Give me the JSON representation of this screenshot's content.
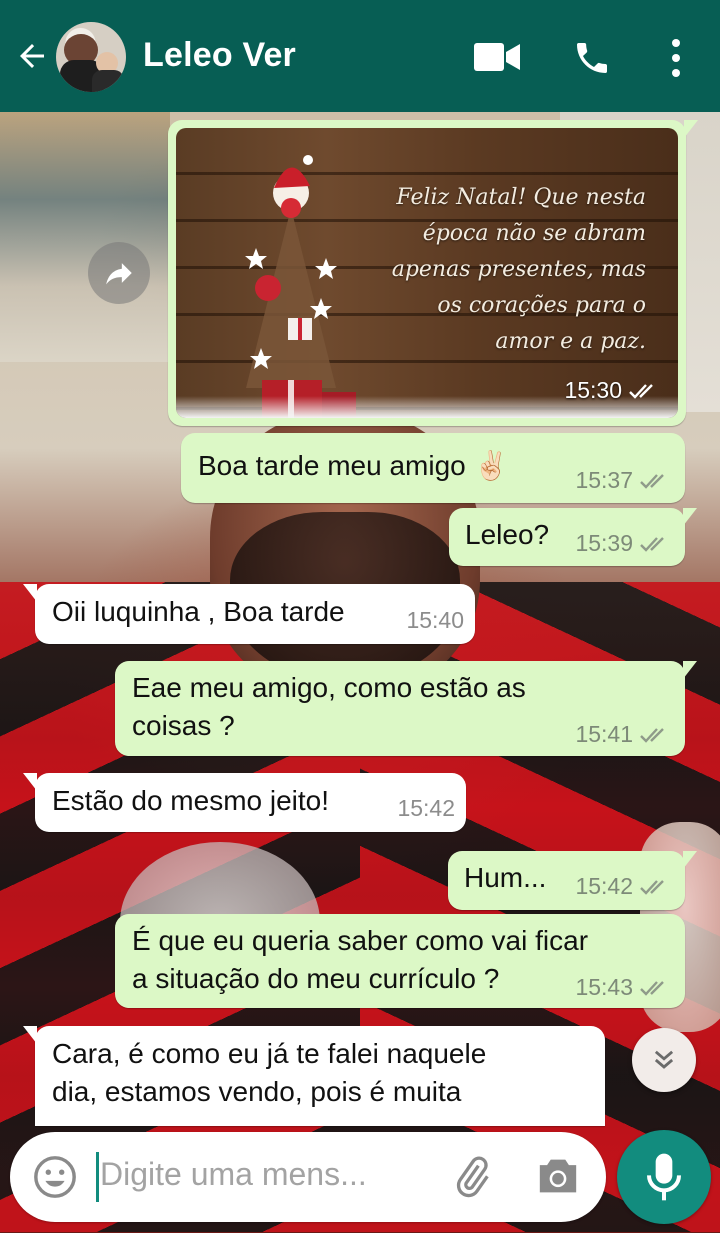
{
  "header": {
    "contact_name": "Leleo Ver",
    "icons": [
      "back-arrow-icon",
      "video-call-icon",
      "phone-call-icon",
      "more-vert-icon"
    ]
  },
  "messages": [
    {
      "type": "image",
      "direction": "out",
      "caption": [
        "Feliz Natal! Que nesta",
        "época não se abram",
        "apenas presentes, mas",
        "os corações para o",
        "amor e a paz."
      ],
      "time": "15:30",
      "status": "read"
    },
    {
      "type": "text",
      "direction": "out",
      "text": "Boa tarde meu amigo ✌🏻",
      "time": "15:37",
      "status": "read"
    },
    {
      "type": "text",
      "direction": "out",
      "text": "Leleo?",
      "time": "15:39",
      "status": "read"
    },
    {
      "type": "text",
      "direction": "in",
      "text": "Oii luquinha , Boa tarde",
      "time": "15:40"
    },
    {
      "type": "text",
      "direction": "out",
      "lines": [
        "Eae meu amigo, como estão as",
        "coisas ?"
      ],
      "time": "15:41",
      "status": "read"
    },
    {
      "type": "text",
      "direction": "in",
      "text": "Estão do mesmo jeito!",
      "time": "15:42"
    },
    {
      "type": "text",
      "direction": "out",
      "text": "Hum...",
      "time": "15:42",
      "status": "read"
    },
    {
      "type": "text",
      "direction": "out",
      "lines": [
        "É que eu queria saber como vai ficar",
        "a situação do meu currículo ?"
      ],
      "time": "15:43",
      "status": "read"
    },
    {
      "type": "text",
      "direction": "in",
      "lines": [
        "Cara, é como eu já te falei naquele",
        "dia, estamos vendo, pois é muita"
      ],
      "time": ""
    }
  ],
  "composer": {
    "placeholder": "Digite uma mens..."
  },
  "colors": {
    "header": "#075e54",
    "outgoing_bubble": "#dcf8c6",
    "incoming_bubble": "#ffffff",
    "mic_button": "#128c7e"
  }
}
